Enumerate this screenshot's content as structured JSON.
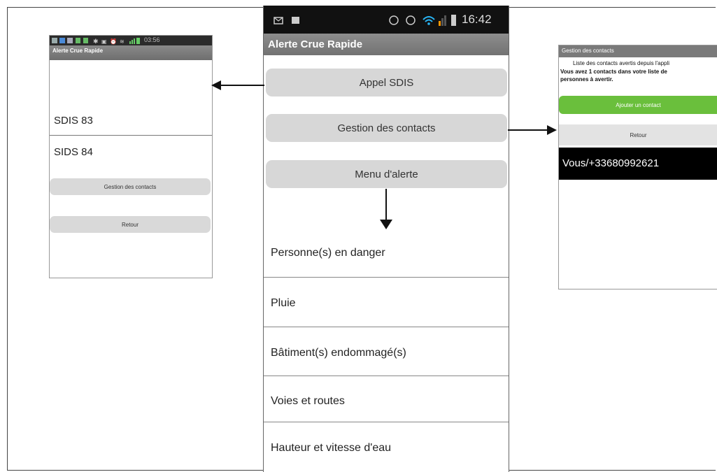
{
  "left_screen": {
    "status_time": "03:56",
    "title": "Alerte Crue Rapide",
    "items": [
      "SDIS 83",
      "SIDS 84"
    ],
    "buttons": [
      "Gestion des contacts",
      "Retour"
    ]
  },
  "center_screen": {
    "status_time": "16:42",
    "title": "Alerte Crue Rapide",
    "buttons": [
      "Appel SDIS",
      "Gestion des contacts",
      "Menu d'alerte"
    ],
    "alert_items": [
      "Personne(s) en danger",
      "Pluie",
      "Bâtiment(s) endommagé(s)",
      "Voies et routes",
      "Hauteur et vitesse d'eau"
    ]
  },
  "right_screen": {
    "title": "Gestion des contacts",
    "header_text": "Liste des contacts avertis depuis l'appli",
    "info_line1": "Vous avez  1 contacts dans votre liste de",
    "info_line2": "personnes à avertir.",
    "add_button": "Ajouter un contact",
    "back_button": "Retour",
    "contact": "Vous/+33680992621"
  },
  "colors": {
    "add_button": "#6abf3c",
    "title_bar": "#7a7a7a"
  },
  "icons": [
    "message-icon",
    "image-icon",
    "rotation-icon",
    "alarm-icon",
    "wifi-icon",
    "signal-icon",
    "battery-icon",
    "arrow-left-icon",
    "arrow-right-icon",
    "arrow-down-icon"
  ]
}
